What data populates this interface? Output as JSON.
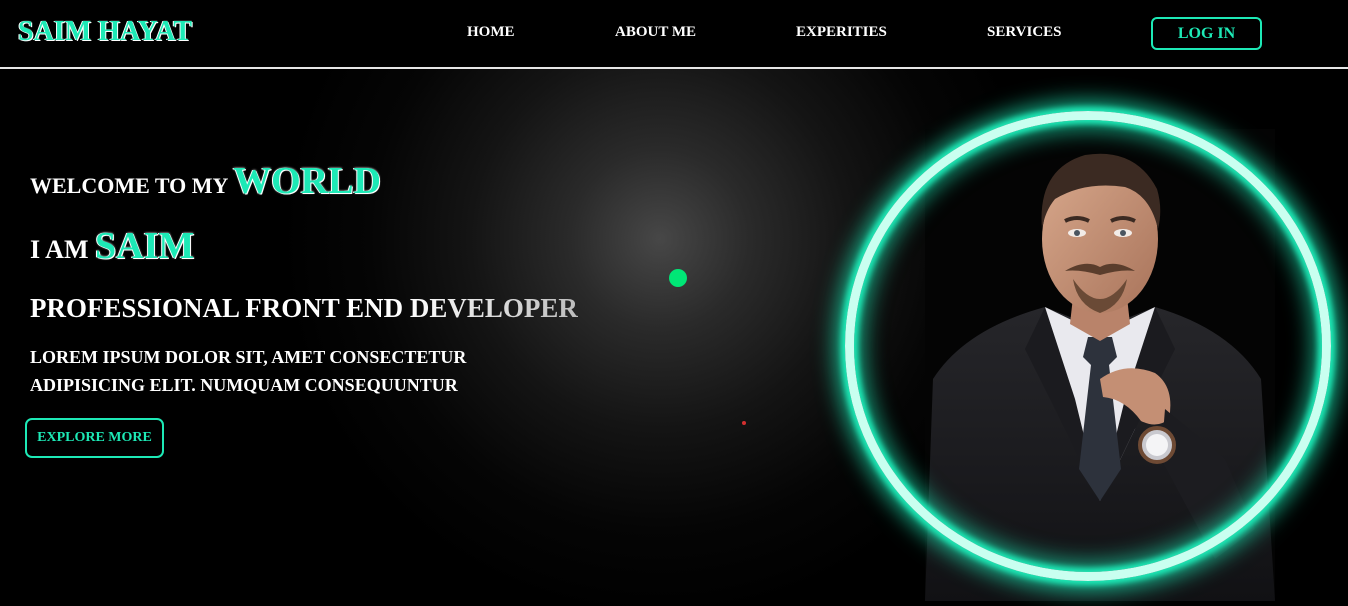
{
  "header": {
    "logo": "SAIM HAYAT",
    "nav": [
      "HOME",
      "ABOUT ME",
      "EXPERITIES",
      "SERVICES"
    ],
    "login_label": "LOG IN"
  },
  "hero": {
    "welcome_prefix": "WELCOME TO MY",
    "welcome_accent": "WORLD",
    "iam_prefix": "I AM",
    "iam_accent": "SAIM",
    "role": "PROFESSIONAL FRONT END DEVELOPER",
    "description_line1": "LOREM IPSUM DOLOR SIT, AMET CONSECTETUR",
    "description_line2": "ADIPISICING ELIT. NUMQUAM CONSEQUUNTUR",
    "explore_label": "EXPLORE MORE"
  },
  "colors": {
    "accent": "#1de9b6",
    "background": "#000000",
    "text": "#ffffff",
    "green_dot": "#00e676",
    "red_dot": "#d32f2f"
  }
}
